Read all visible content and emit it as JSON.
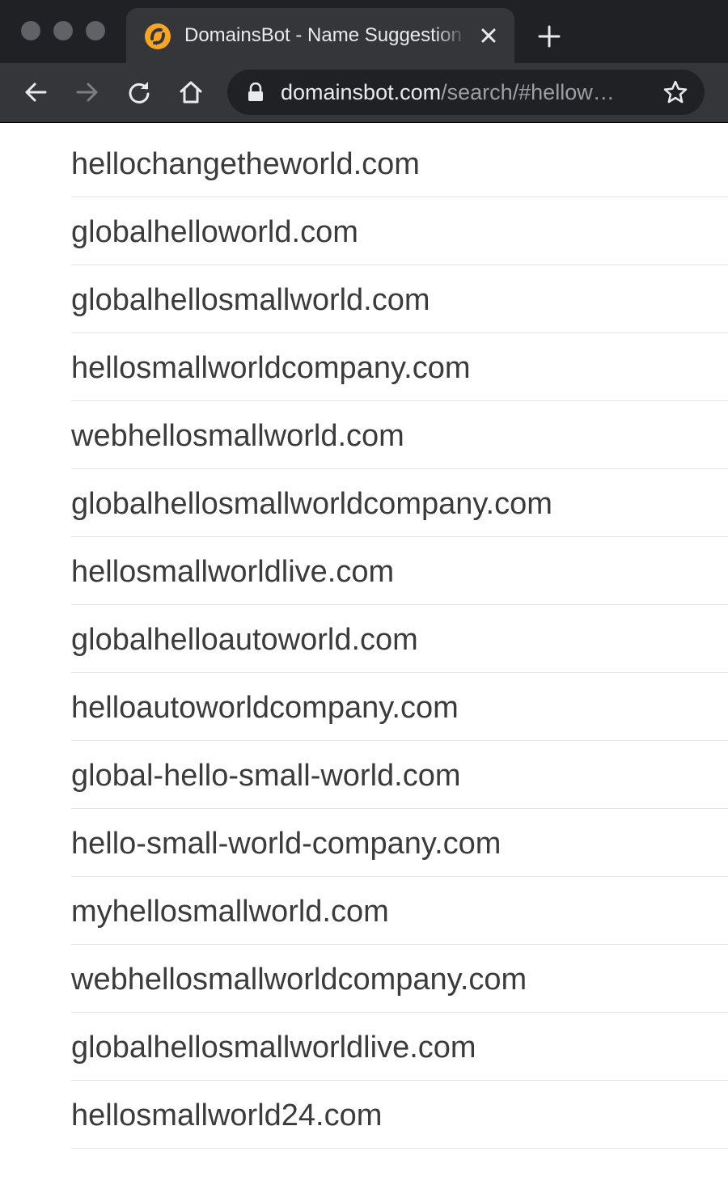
{
  "tab": {
    "title": "DomainsBot - Name Suggestion",
    "favicon": "domainsbot-logo-icon",
    "close_icon": "close-icon",
    "new_tab_icon": "plus-icon"
  },
  "toolbar": {
    "back_icon": "arrow-left-icon",
    "forward_icon": "arrow-right-icon",
    "reload_icon": "reload-icon",
    "home_icon": "home-icon",
    "lock_icon": "lock-icon",
    "bookmark_icon": "star-icon"
  },
  "address_bar": {
    "host": "domainsbot.com",
    "path": "/search/#hellow…"
  },
  "domains": [
    "hellochangetheworld.com",
    "globalhelloworld.com",
    "globalhellosmallworld.com",
    "hellosmallworldcompany.com",
    "webhellosmallworld.com",
    "globalhellosmallworldcompany.com",
    "hellosmallworldlive.com",
    "globalhelloautoworld.com",
    "helloautoworldcompany.com",
    "global-hello-small-world.com",
    "hello-small-world-company.com",
    "myhellosmallworld.com",
    "webhellosmallworldcompany.com",
    "globalhellosmallworldlive.com",
    "hellosmallworld24.com"
  ],
  "colors": {
    "chrome_dark": "#202124",
    "chrome_toolbar": "#35363a",
    "favicon_accent": "#f5a623",
    "domain_text": "#3b3b3b",
    "divider": "#e3e3e3"
  }
}
